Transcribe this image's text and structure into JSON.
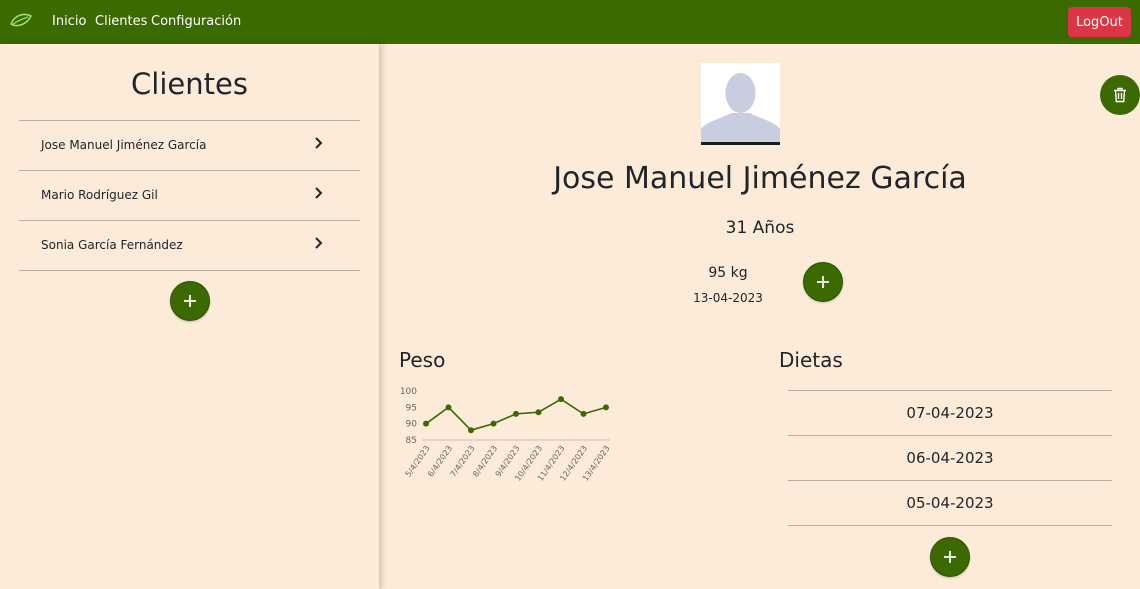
{
  "navbar": {
    "links": [
      "Inicio",
      "Clientes",
      "Configuración"
    ],
    "logout_label": "LogOut",
    "bg_color": "#3b6a00",
    "logout_color": "#dc3545"
  },
  "sidebar": {
    "title": "Clientes",
    "clients": [
      "Jose Manuel Jiménez García",
      "Mario Rodríguez Gil",
      "Sonia García Fernández"
    ]
  },
  "profile": {
    "name": "Jose Manuel Jiménez García",
    "age": "31 Años",
    "weight": "95 kg",
    "weight_date": "13-04-2023"
  },
  "weight_section": {
    "title": "Peso"
  },
  "diets_section": {
    "title": "Dietas",
    "dates": [
      "07-04-2023",
      "06-04-2023",
      "05-04-2023"
    ]
  },
  "icons": {
    "brand": "leaf-logo-icon",
    "add": "plus-icon",
    "delete": "trash-icon",
    "chevron": "chevron-right-icon"
  },
  "chart_data": {
    "type": "line",
    "categories": [
      "5/4/2023",
      "6/4/2023",
      "7/4/2023",
      "8/4/2023",
      "9/4/2023",
      "10/4/2023",
      "11/4/2023",
      "12/4/2023",
      "13/4/2023"
    ],
    "values": [
      90,
      95,
      88,
      90,
      93,
      93.5,
      97.5,
      93,
      95
    ],
    "ylim": [
      85,
      100
    ],
    "yticks": [
      85,
      90,
      95,
      100
    ],
    "color": "#3b6a00",
    "title": "",
    "xlabel": "",
    "ylabel": ""
  }
}
